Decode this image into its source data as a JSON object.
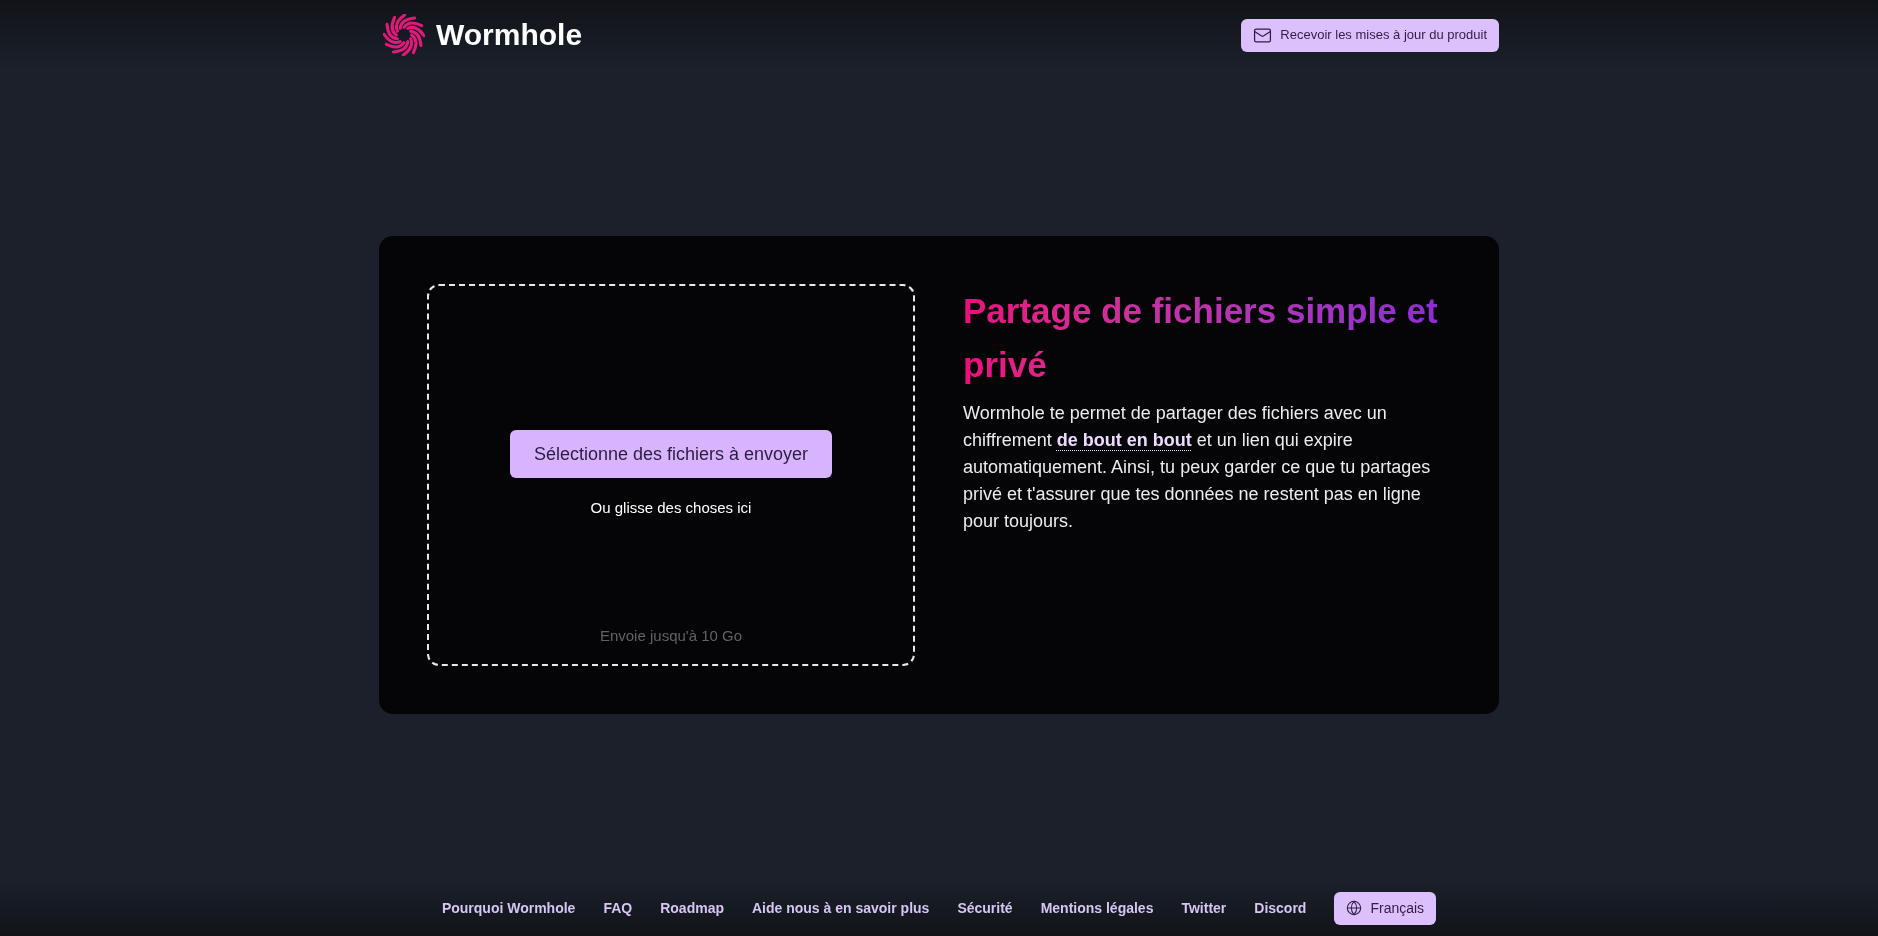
{
  "header": {
    "logo_text": "Wormhole",
    "updates_button": "Recevoir les mises à jour du produit"
  },
  "upload": {
    "select_button": "Sélectionne des fichiers à envoyer",
    "drop_hint": "Ou glisse des choses ici",
    "size_limit": "Envoie jusqu'à 10 Go"
  },
  "intro": {
    "title": "Partage de fichiers simple et privé",
    "text_before": "Wormhole te permet de partager des fichiers avec un chiffrement",
    "term_link": "de bout en bout",
    "text_after": "et un lien qui expire automatiquement. Ainsi, tu peux garder ce que tu partages privé et t'assurer que tes données ne restent pas en ligne pour toujours."
  },
  "footer": {
    "links": [
      "Pourquoi Wormhole",
      "FAQ",
      "Roadmap",
      "Aide nous à en savoir plus",
      "Sécurité",
      "Mentions légales",
      "Twitter",
      "Discord"
    ],
    "language_button": "Français"
  }
}
